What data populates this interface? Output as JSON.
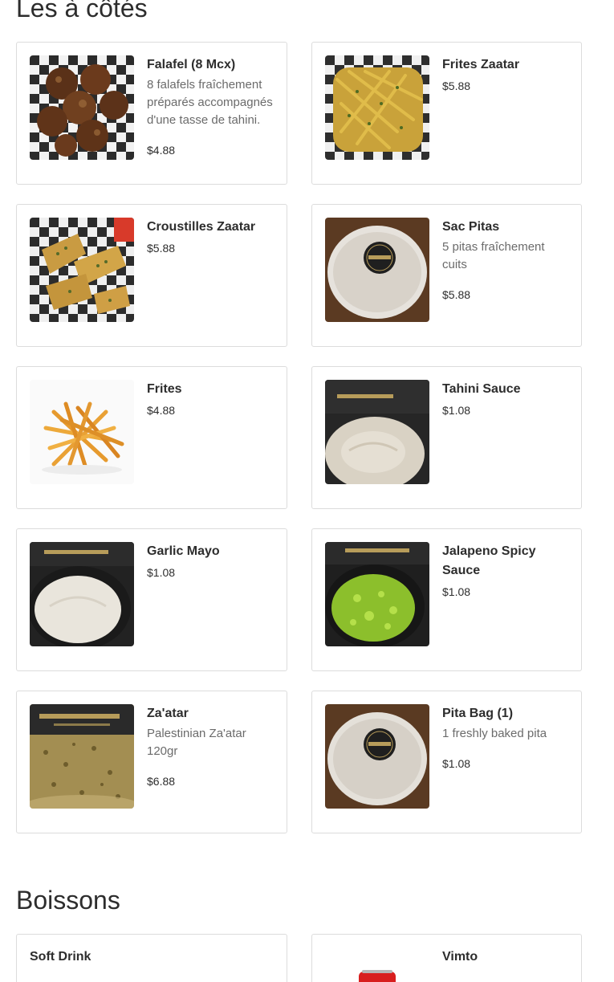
{
  "sections": [
    {
      "title": "Les à côtés",
      "items": [
        {
          "name": "Falafel (8 Mcx)",
          "description": "8 falafels fraîchement préparés accompagnés d'une tasse de tahini.",
          "price": "$4.88",
          "image": "falafel-basket-photo"
        },
        {
          "name": "Frites Zaatar",
          "description": "",
          "price": "$5.88",
          "image": "zaatar-fries-photo"
        },
        {
          "name": "Croustilles Zaatar",
          "description": "",
          "price": "$5.88",
          "image": "zaatar-chips-photo"
        },
        {
          "name": "Sac Pitas",
          "description": "5 pitas fraîchement cuits",
          "price": "$5.88",
          "image": "pita-bag-photo"
        },
        {
          "name": "Frites",
          "description": "",
          "price": "$4.88",
          "image": "fries-photo"
        },
        {
          "name": "Tahini Sauce",
          "description": "",
          "price": "$1.08",
          "image": "tahini-sauce-photo"
        },
        {
          "name": "Garlic Mayo",
          "description": "",
          "price": "$1.08",
          "image": "garlic-mayo-photo"
        },
        {
          "name": "Jalapeno Spicy Sauce",
          "description": "",
          "price": "$1.08",
          "image": "jalapeno-sauce-photo"
        },
        {
          "name": "Za'atar",
          "description": "Palestinian Za'atar 120gr",
          "price": "$6.88",
          "image": "zaatar-tub-photo"
        },
        {
          "name": "Pita Bag (1)",
          "description": "1 freshly baked pita",
          "price": "$1.08",
          "image": "single-pita-photo"
        }
      ]
    },
    {
      "title": "Boissons",
      "items": [
        {
          "name": "Soft Drink",
          "description": "",
          "price": "",
          "image": ""
        },
        {
          "name": "Vimto",
          "description": "",
          "price": "",
          "image": "vimto-can-photo"
        }
      ]
    }
  ],
  "colors": {
    "text": "#2d2d2d",
    "muted": "#6b6b6b",
    "border": "#dcdcdc",
    "vimto_red": "#d81e1e"
  }
}
